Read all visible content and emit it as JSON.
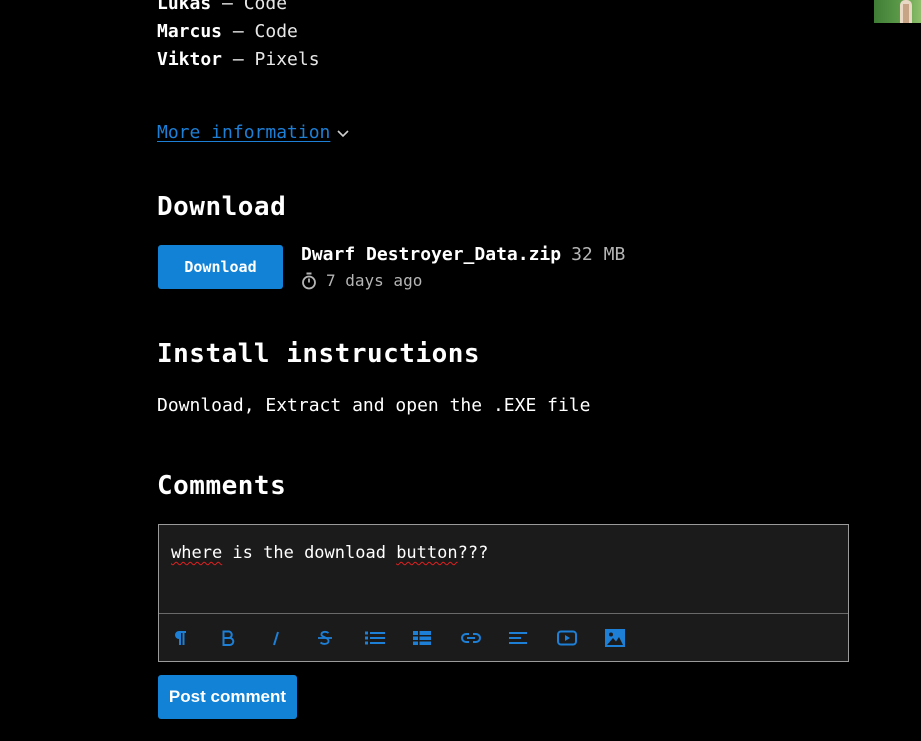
{
  "credits": [
    {
      "name": "Lukas",
      "sep": " – ",
      "role": "Code"
    },
    {
      "name": "Marcus",
      "sep": " – ",
      "role": "Code"
    },
    {
      "name": "Viktor",
      "sep": " – ",
      "role": "Pixels"
    }
  ],
  "more_info": {
    "label": "More information",
    "icon": "chevron-down-icon"
  },
  "download_section": {
    "heading": "Download",
    "button_label": "Download",
    "file_name": "Dwarf Destroyer_Data.zip",
    "file_size": "32 MB",
    "uploaded": "7 days ago",
    "date_icon": "stopwatch-icon"
  },
  "install_section": {
    "heading": "Install instructions",
    "text": "Download, Extract and open the .EXE file"
  },
  "comments_section": {
    "heading": "Comments",
    "editor": {
      "words": [
        "where",
        " is the download ",
        "button",
        "???"
      ],
      "toolbar": [
        {
          "name": "paragraph-icon"
        },
        {
          "name": "bold-icon"
        },
        {
          "name": "italic-icon"
        },
        {
          "name": "strikethrough-icon"
        },
        {
          "name": "bulleted-list-icon"
        },
        {
          "name": "table-icon"
        },
        {
          "name": "link-icon"
        },
        {
          "name": "align-icon"
        },
        {
          "name": "video-icon"
        },
        {
          "name": "image-icon"
        }
      ]
    },
    "post_label": "Post comment"
  },
  "colors": {
    "background": "#000000",
    "accent": "#1182d6",
    "link": "#1d7fd6",
    "editor_bg": "#1b1b1b",
    "muted": "#b5b5b5",
    "spellcheck": "#e02020"
  }
}
